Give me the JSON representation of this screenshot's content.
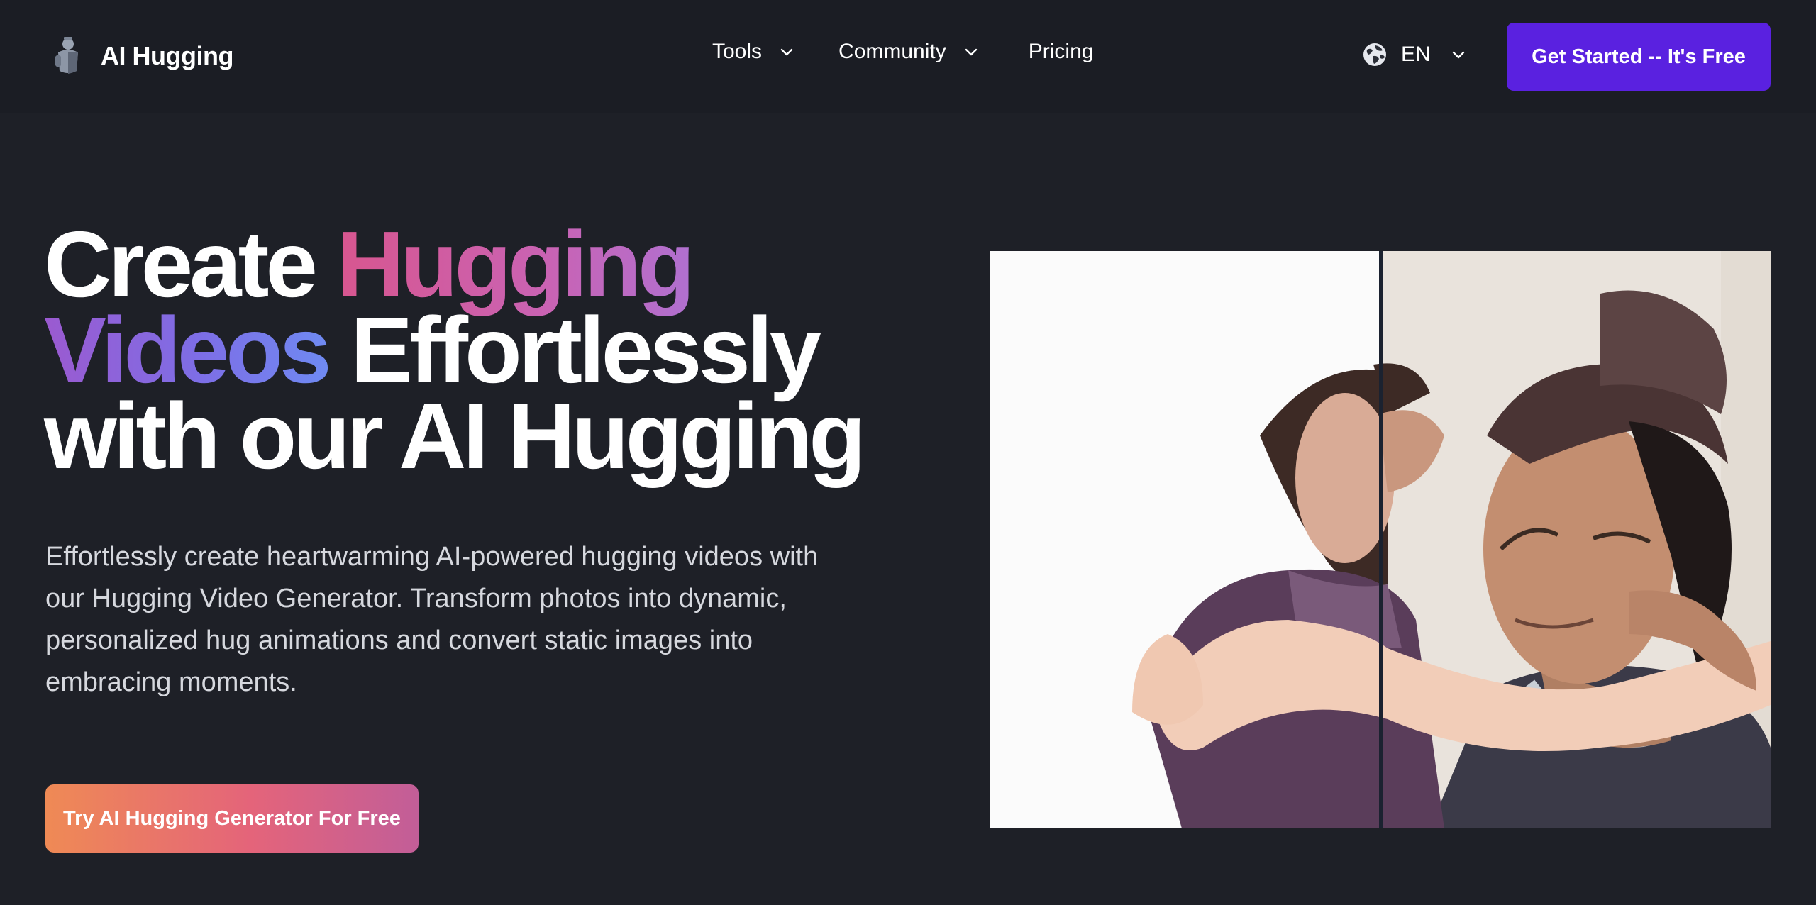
{
  "brand": {
    "name": "AI Hugging",
    "logo_icon": "knight-logo-icon"
  },
  "nav": {
    "tools_label": "Tools",
    "community_label": "Community",
    "pricing_label": "Pricing"
  },
  "language": {
    "current": "EN",
    "icon": "globe-icon"
  },
  "header_cta": {
    "label": "Get Started -- It's Free"
  },
  "hero": {
    "title_word_1": "Create",
    "title_word_2": "Hugging",
    "title_word_3": "Videos",
    "title_word_4": "Effortlessly",
    "title_line_3": "with our AI Hugging",
    "description": "Effortlessly create heartwarming AI-powered hugging videos with our Hugging Video Generator. Transform photos into dynamic, personalized hug animations and convert static images into embracing moments.",
    "cta_label": "Try AI Hugging Generator For Free"
  },
  "colors": {
    "background": "#1e2027",
    "header_background": "#1b1d24",
    "primary_button": "#5a21e0",
    "gradient_start": "#ef8a55",
    "gradient_end": "#c25e98"
  }
}
